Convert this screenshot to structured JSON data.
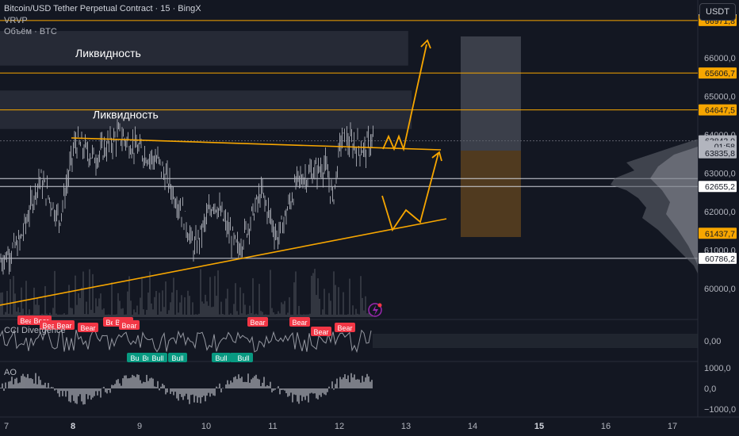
{
  "header": {
    "title": "Bitcoin/USD Tether Perpetual Contract · 15 · BingX",
    "indicator_1": "VRVP",
    "indicator_2": "Объём · BTC"
  },
  "currency_button": "USDT",
  "zones": [
    {
      "label": "Ликвидность",
      "price_top": 66700,
      "price_bottom": 65800,
      "x0": 0,
      "x1": 0.585
    },
    {
      "label": "Ликвидность",
      "price_top": 65150,
      "price_bottom": 64150,
      "x0": 0,
      "x1": 0.59
    }
  ],
  "price_axis": {
    "ticks": [
      "66000,0",
      "65000,0",
      "64000,0",
      "63000,0",
      "62000,0",
      "61000,0",
      "60000,0"
    ],
    "tick_values": [
      66000,
      65000,
      64000,
      63000,
      62000,
      61000,
      60000
    ]
  },
  "price_tags": [
    {
      "text": "66990,3",
      "value": 66990.3,
      "style": "white"
    },
    {
      "text": "66971,8",
      "value": 66971.8,
      "style": "orange"
    },
    {
      "text": "65606,7",
      "value": 65606.7,
      "style": "orange"
    },
    {
      "text": "64647,5",
      "value": 64647.5,
      "style": "orange"
    },
    {
      "text": "63843,0",
      "value": 63843.0,
      "style": "gray"
    },
    {
      "text": "01:58",
      "value": 63700,
      "style": "gray"
    },
    {
      "text": "63835,8",
      "value": 63530,
      "style": "gray"
    },
    {
      "text": "62655,2",
      "value": 62655.2,
      "style": "white"
    },
    {
      "text": "61437,7",
      "value": 61437.7,
      "style": "orange"
    },
    {
      "text": "60786,2",
      "value": 60786.2,
      "style": "white"
    }
  ],
  "horizontal_lines": [
    {
      "value": 66971.8,
      "color": "#f7a600"
    },
    {
      "value": 65606.7,
      "color": "#f7a600"
    },
    {
      "value": 64647.5,
      "color": "#f7a600"
    },
    {
      "value": 63843.0,
      "color": "#5d606b"
    },
    {
      "value": 62860,
      "color": "#d1d4dc"
    },
    {
      "value": 62655.2,
      "color": "#d1d4dc"
    },
    {
      "value": 60786.2,
      "color": "#d1d4dc"
    }
  ],
  "cci": {
    "label": "CCI Divergence",
    "axis_tick": "0,00",
    "bear_tags": [
      "Bear",
      "Bear",
      "Bear",
      "Bear",
      "Bear",
      "Bear",
      "Bear",
      "Bear",
      "Bear",
      "Bear",
      "Bear",
      "Bear"
    ],
    "bull_tags": [
      "Bull",
      "Bull",
      "Bull",
      "Bull",
      "Bull",
      "Bull",
      "Bull"
    ]
  },
  "ao": {
    "label": "AO",
    "axis_ticks": [
      "1000,0",
      "0,0",
      "−1000,0"
    ]
  },
  "time_axis": {
    "labels": [
      "7",
      "8",
      "9",
      "10",
      "11",
      "12",
      "13",
      "14",
      "15",
      "16",
      "17"
    ],
    "bold": [
      "8",
      "15"
    ]
  },
  "colors": {
    "background": "#131722",
    "orange": "#f7a600",
    "bear": "#f23645",
    "bull": "#089981",
    "candle": "#b2b5be"
  }
}
